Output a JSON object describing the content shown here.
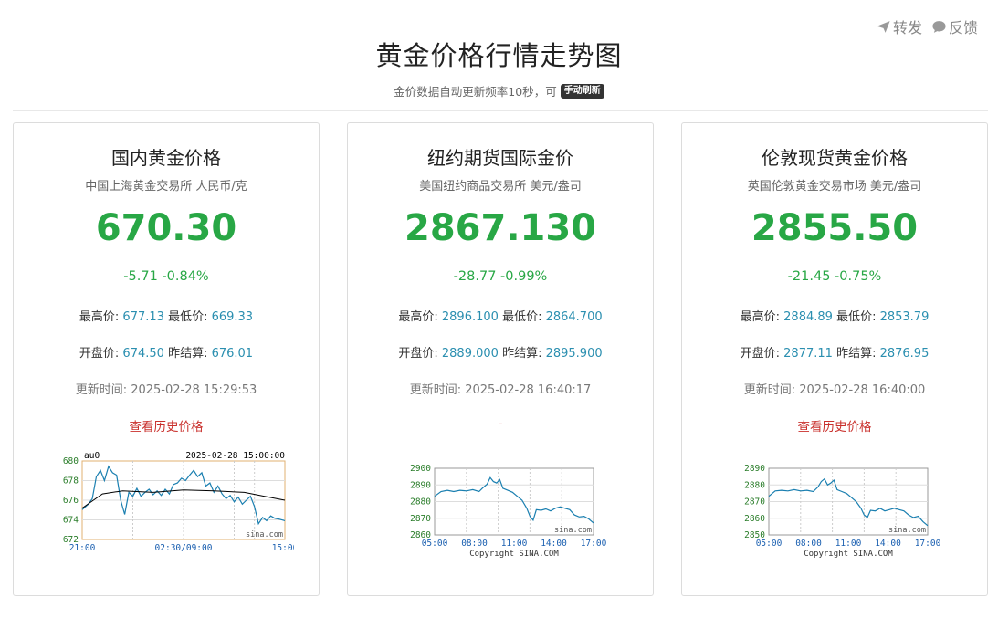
{
  "top_actions": {
    "share": "转发",
    "feedback": "反馈"
  },
  "header": {
    "title": "黄金价格行情走势图",
    "subtitle": "金价数据自动更新频率10秒，可",
    "refresh": "手动刷新"
  },
  "labels": {
    "high": "最高价:",
    "low": "最低价:",
    "open": "开盘价:",
    "prev": "昨结算:"
  },
  "cards": [
    {
      "title": "国内黄金价格",
      "subtitle": "中国上海黄金交易所 人民币/克",
      "price": "670.30",
      "change": "-5.71 -0.84%",
      "high": "677.13",
      "low": "669.33",
      "open": "674.50",
      "prev": "676.01",
      "updated": "更新时间: 2025-02-28 15:29:53",
      "history": "查看历史价格",
      "chart": {
        "symbol": "au0",
        "datetime": "2025-02-28 15:00:00",
        "y_ticks": [
          "680",
          "678",
          "676",
          "674",
          "672"
        ],
        "x_ticks": [
          "21:00",
          "02:30/09:00",
          "15:00"
        ],
        "watermark": "sina.com",
        "copyright": ""
      }
    },
    {
      "title": "纽约期货国际金价",
      "subtitle": "美国纽约商品交易所 美元/盎司",
      "price": "2867.130",
      "change": "-28.77 -0.99%",
      "high": "2896.100",
      "low": "2864.700",
      "open": "2889.000",
      "prev": "2895.900",
      "updated": "更新时间: 2025-02-28 16:40:17",
      "history": "-",
      "chart": {
        "symbol": "",
        "datetime": "",
        "y_ticks": [
          "2900",
          "2890",
          "2880",
          "2870",
          "2860"
        ],
        "x_ticks": [
          "05:00",
          "08:00",
          "11:00",
          "14:00",
          "17:00"
        ],
        "watermark": "sina.com",
        "copyright": "Copyright  SINA.COM"
      }
    },
    {
      "title": "伦敦现货黄金价格",
      "subtitle": "英国伦敦黄金交易市场 美元/盎司",
      "price": "2855.50",
      "change": "-21.45 -0.75%",
      "high": "2884.89",
      "low": "2853.79",
      "open": "2877.11",
      "prev": "2876.95",
      "updated": "更新时间: 2025-02-28 16:40:00",
      "history": "查看历史价格",
      "chart": {
        "symbol": "",
        "datetime": "",
        "y_ticks": [
          "2890",
          "2880",
          "2870",
          "2860",
          "2850"
        ],
        "x_ticks": [
          "05:00",
          "08:00",
          "11:00",
          "14:00",
          "17:00"
        ],
        "watermark": "sina.com",
        "copyright": "Copyright  SINA.COM"
      }
    }
  ],
  "colors": {
    "up_down_green": "#28a745",
    "link_red": "#c9302c",
    "value_blue": "#2b8fb0",
    "line_blue": "#1a7fb0"
  }
}
